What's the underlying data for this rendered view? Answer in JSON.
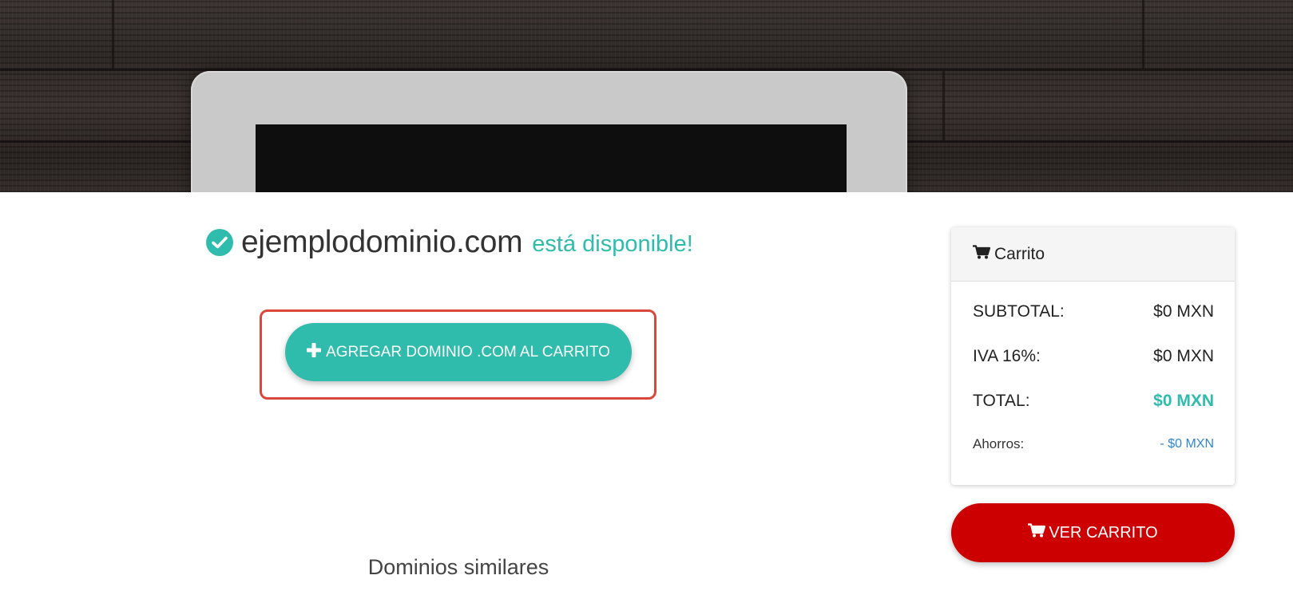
{
  "domain_result": {
    "domain": "ejemplodominio.com",
    "status_text": "está disponible!",
    "status_icon": "check-circle-icon",
    "accent_color": "#2fbcac"
  },
  "add_button": {
    "icon": "plus-icon",
    "label": "AGREGAR DOMINIO .COM AL CARRITO"
  },
  "similar_domains": {
    "title": "Dominios similares"
  },
  "cart": {
    "title": "Carrito",
    "icon": "cart-icon",
    "rows": [
      {
        "label": "SUBTOTAL:",
        "value": "$0 MXN"
      },
      {
        "label": "IVA 16%:",
        "value": "$0 MXN"
      },
      {
        "label": "TOTAL:",
        "value": "$0 MXN"
      },
      {
        "label": "Ahorros:",
        "value": "- $0 MXN"
      }
    ],
    "view_cart_label": "VER CARRITO",
    "view_cart_color": "#cc0000"
  }
}
